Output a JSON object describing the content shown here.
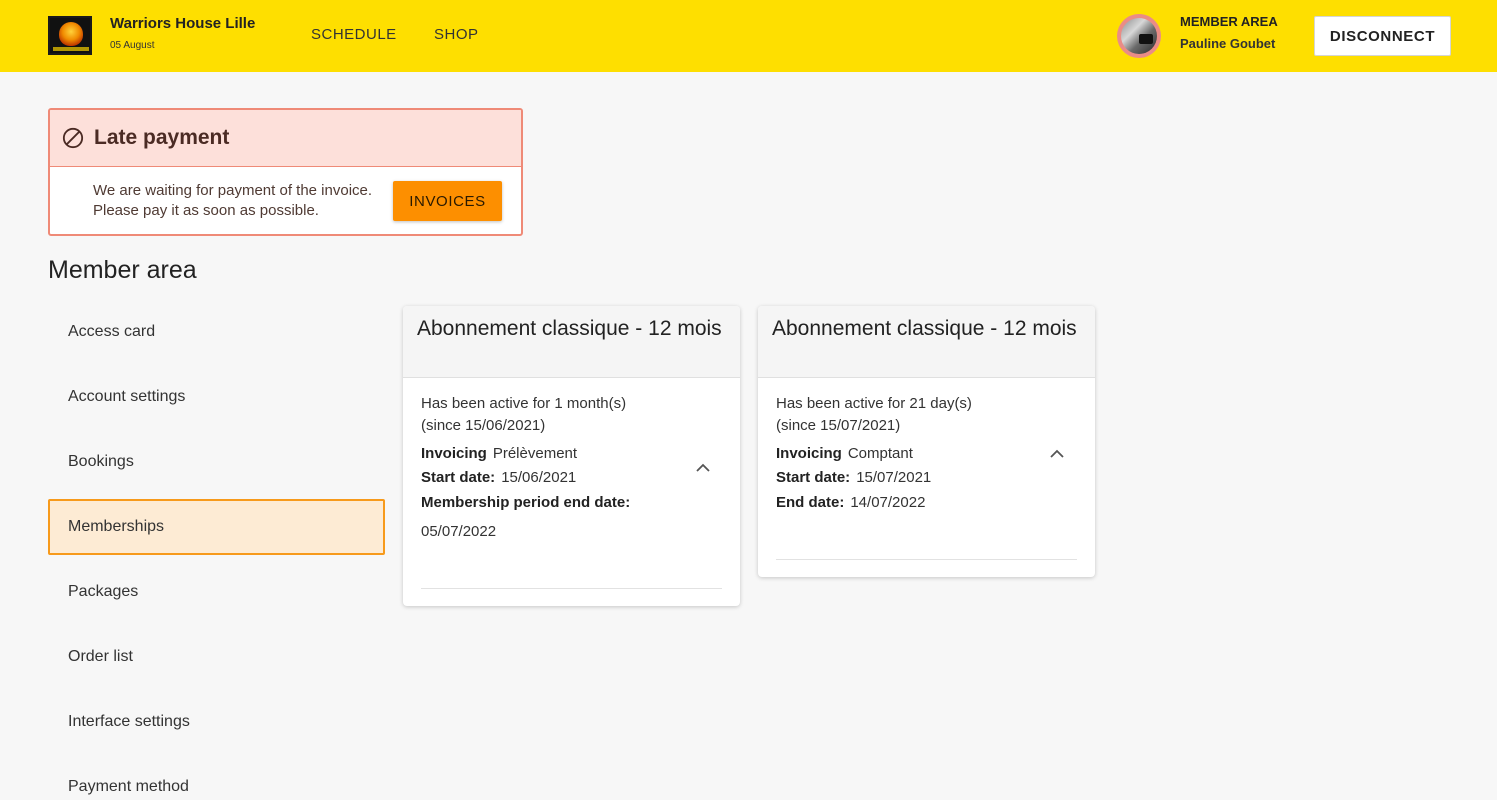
{
  "header": {
    "brand_name": "Warriors House Lille",
    "brand_date": "05 August",
    "nav": [
      "SCHEDULE",
      "SHOP"
    ],
    "member_label": "MEMBER AREA",
    "member_name": "Pauline Goubet",
    "disconnect_label": "DISCONNECT",
    "accent_color": "#fedf00"
  },
  "alert": {
    "title": "Late payment",
    "message_line1": "We are waiting for payment of the invoice.",
    "message_line2": "Please pay it as soon as possible.",
    "button_label": "INVOICES",
    "icon": "ban-icon"
  },
  "page": {
    "title": "Member area"
  },
  "sidebar": {
    "items": [
      {
        "label": "Access card"
      },
      {
        "label": "Account settings"
      },
      {
        "label": "Bookings"
      },
      {
        "label": "Memberships",
        "active": true
      },
      {
        "label": "Packages"
      },
      {
        "label": "Order list"
      },
      {
        "label": "Interface settings"
      },
      {
        "label": "Payment method"
      }
    ]
  },
  "memberships": [
    {
      "title": "Abonnement classique - 12 mois",
      "active_text": "Has been active for 1 month(s) (since 15/06/2021)",
      "invoicing_label": "Invoicing",
      "invoicing_value": "Prélèvement",
      "start_label": "Start date:",
      "start_value": "15/06/2021",
      "end_label": "Membership period end date:",
      "end_value": "05/07/2022"
    },
    {
      "title": "Abonnement classique - 12 mois",
      "active_text": "Has been active for 21 day(s) (since 15/07/2021)",
      "invoicing_label": "Invoicing",
      "invoicing_value": "Comptant",
      "start_label": "Start date:",
      "start_value": "15/07/2021",
      "end_label": "End date:",
      "end_value": "14/07/2022"
    }
  ]
}
